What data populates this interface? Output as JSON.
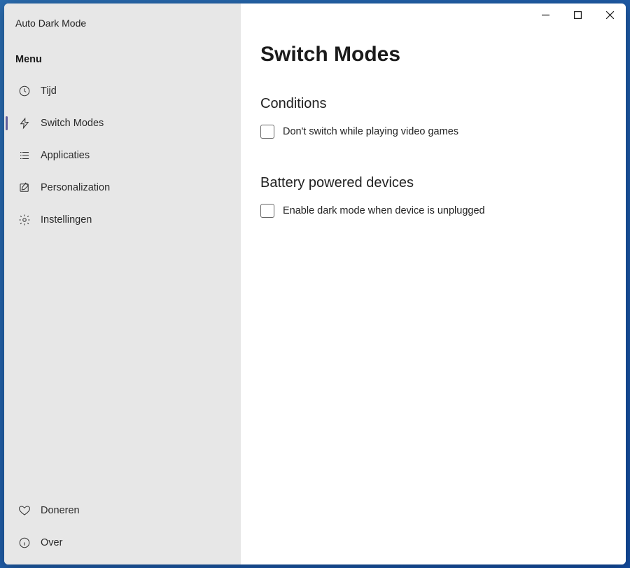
{
  "app": {
    "title": "Auto Dark Mode"
  },
  "sidebar": {
    "menu_label": "Menu",
    "items": [
      {
        "label": "Tijd",
        "icon": "clock-icon"
      },
      {
        "label": "Switch Modes",
        "icon": "lightning-icon"
      },
      {
        "label": "Applicaties",
        "icon": "list-icon"
      },
      {
        "label": "Personalization",
        "icon": "edit-square-icon"
      },
      {
        "label": "Instellingen",
        "icon": "gear-icon"
      }
    ],
    "footer_items": [
      {
        "label": "Doneren",
        "icon": "heart-icon"
      },
      {
        "label": "Over",
        "icon": "info-icon"
      }
    ]
  },
  "page": {
    "title": "Switch Modes",
    "sections": [
      {
        "title": "Conditions",
        "option_label": "Don't switch while playing video games",
        "option_checked": false
      },
      {
        "title": "Battery powered devices",
        "option_label": "Enable dark mode when device is unplugged",
        "option_checked": false
      }
    ]
  }
}
